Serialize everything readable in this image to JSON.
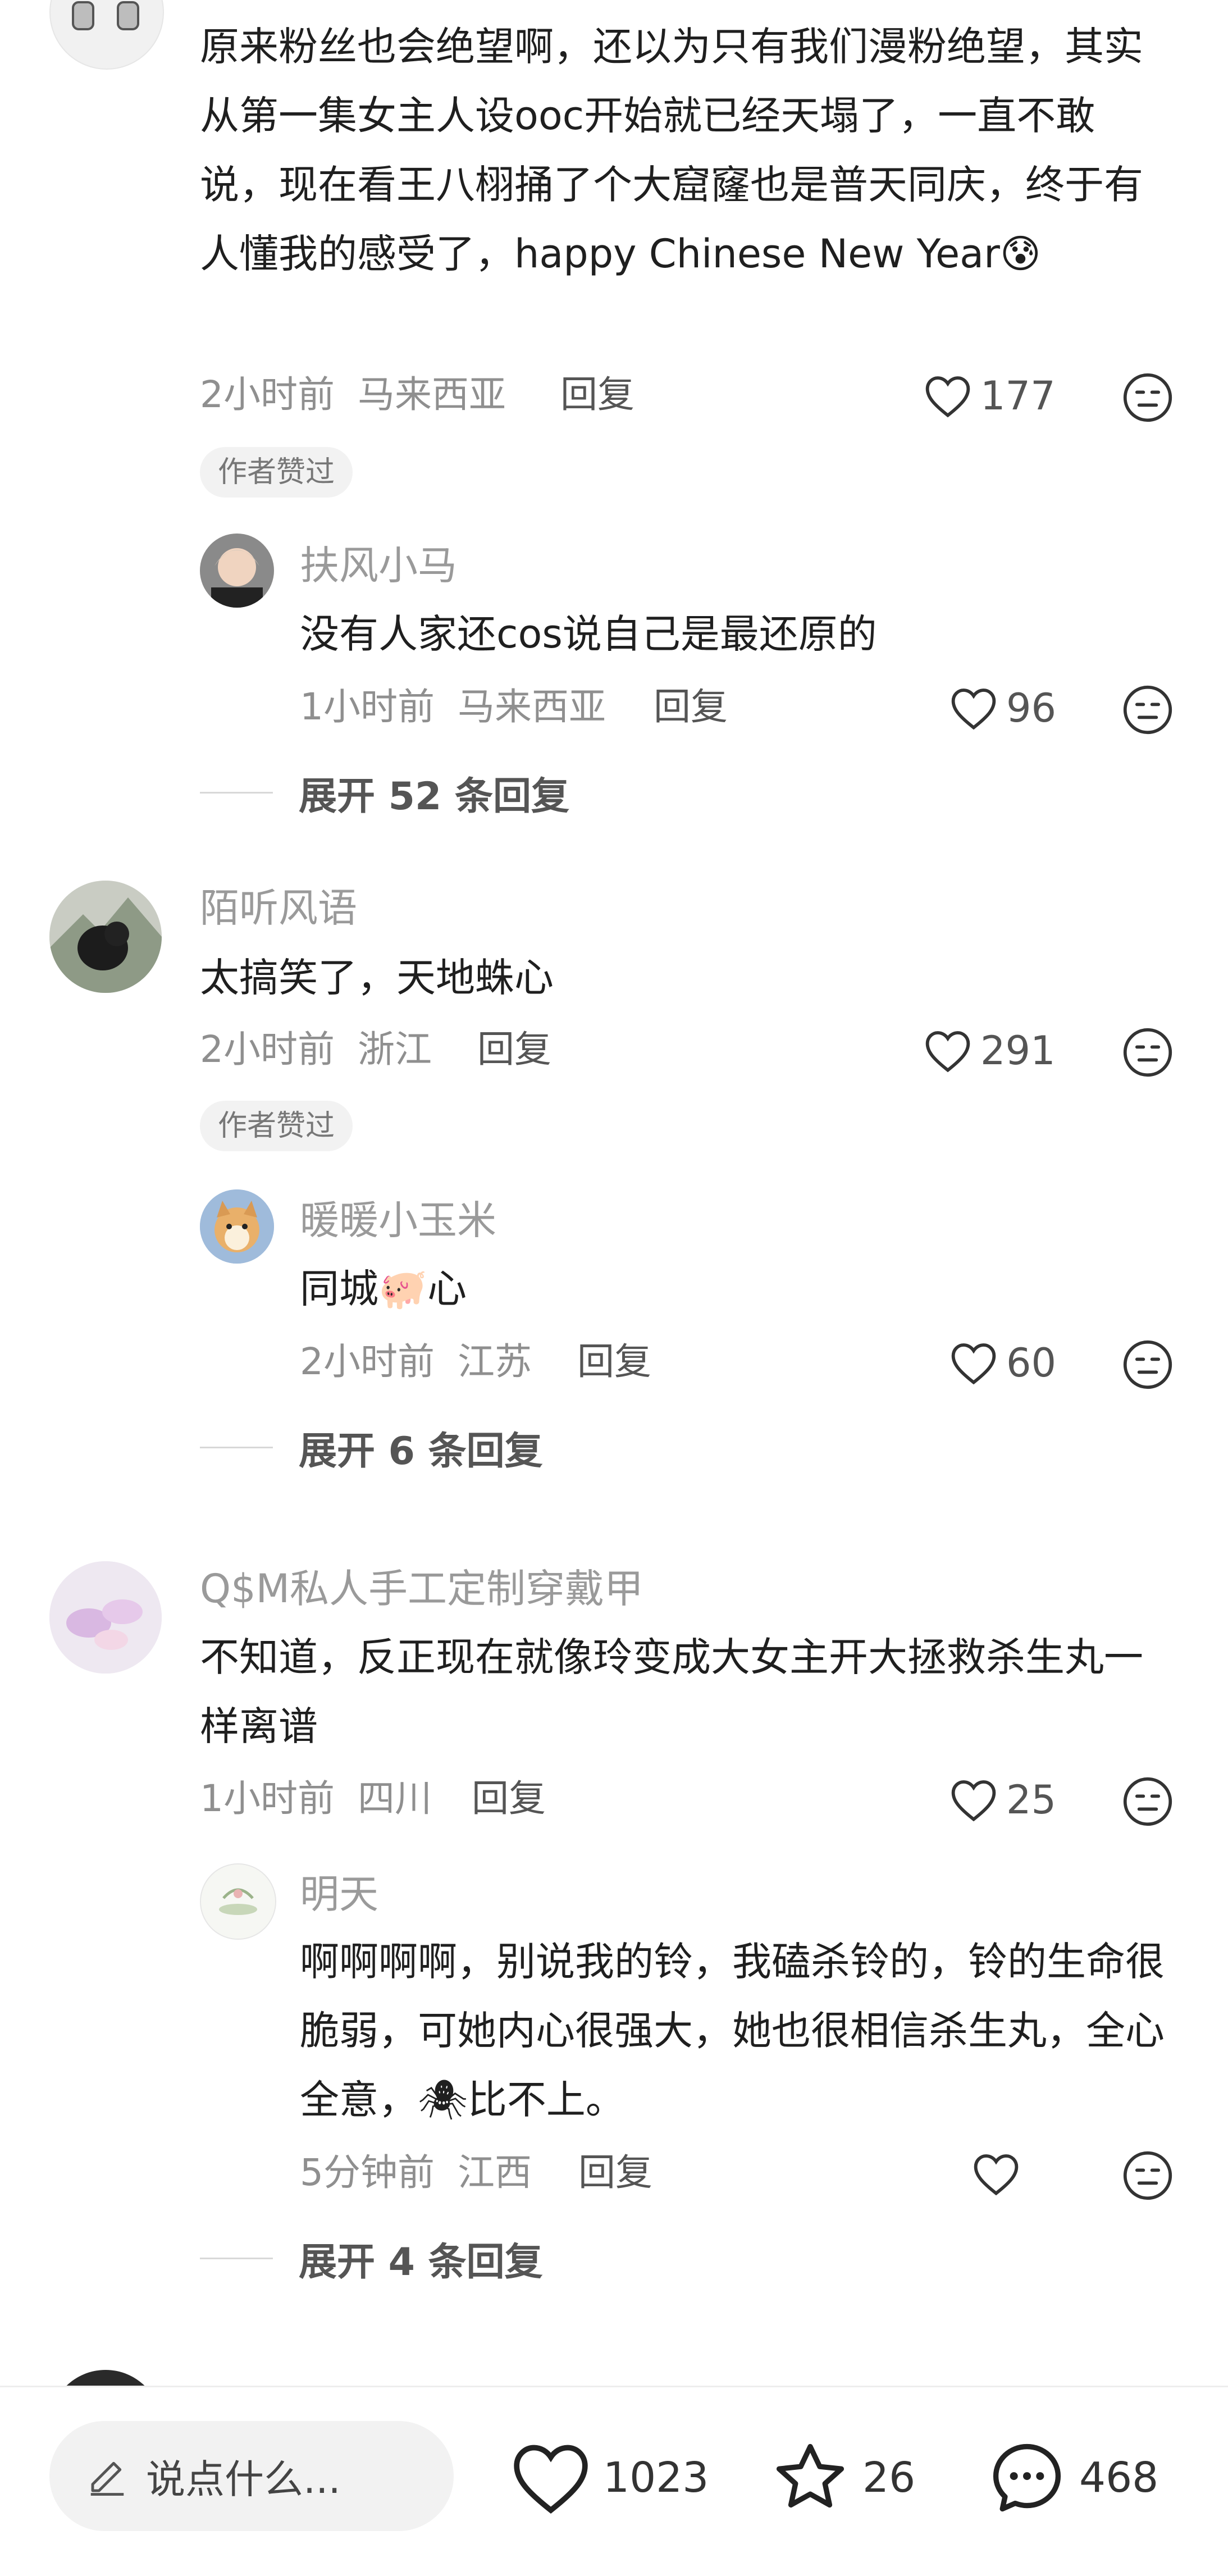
{
  "comments": [
    {
      "text": "原来粉丝也会绝望啊，还以为只有我们漫粉绝望，其实从第一集女主人设ooc开始就已经天塌了，一直不敢说，现在看王八栩捅了个大窟窿也是普天同庆，终于有人懂我的感受了，happy Chinese New Year",
      "emoji": "😰",
      "time": "2小时前",
      "location": "马来西亚",
      "reply_label": "回复",
      "likes": "177",
      "badge": "作者赞过",
      "replies": [
        {
          "name": "扶风小马",
          "text": "没有人家还cos说自己是最还原的",
          "time": "1小时前",
          "location": "马来西亚",
          "reply_label": "回复",
          "likes": "96"
        }
      ],
      "expand": "展开 52 条回复"
    },
    {
      "name": "陌听风语",
      "text": "太搞笑了，天地蛛心",
      "time": "2小时前",
      "location": "浙江",
      "reply_label": "回复",
      "likes": "291",
      "badge": "作者赞过",
      "replies": [
        {
          "name": "暖暖小玉米",
          "text_before": "同城",
          "emoji": "🐖",
          "text_after": "心",
          "time": "2小时前",
          "location": "江苏",
          "reply_label": "回复",
          "likes": "60"
        }
      ],
      "expand": "展开 6 条回复"
    },
    {
      "name": "Q$M私人手工定制穿戴甲",
      "text": "不知道，反正现在就像玲变成大女主开大拯救杀生丸一样离谱",
      "time": "1小时前",
      "location": "四川",
      "reply_label": "回复",
      "likes": "25",
      "replies": [
        {
          "name": "明天",
          "text_before": "啊啊啊啊，别说我的铃，我磕杀铃的，铃的生命很脆弱，可她内心很强大，她也很相信杀生丸，全心全意，",
          "emoji": "🕷",
          "text_after": "比不上。",
          "time": "5分钟前",
          "location": "江西",
          "reply_label": "回复",
          "likes": ""
        }
      ],
      "expand": "展开 4 条回复"
    }
  ],
  "bottom_bar": {
    "input_placeholder": "说点什么...",
    "likes": "1023",
    "favorites": "26",
    "comments": "468"
  },
  "colors": {
    "text": "#1f1f1f",
    "muted": "#9a9a9a",
    "badge_bg": "#f2f2f2"
  },
  "icons": [
    "heart-icon",
    "meh-face-icon",
    "pencil-icon",
    "star-icon",
    "chat-bubble-icon"
  ]
}
